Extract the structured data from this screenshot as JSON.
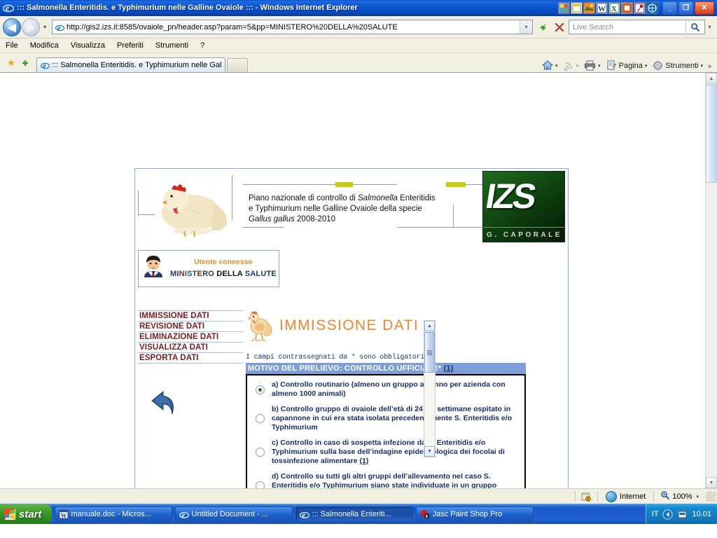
{
  "window": {
    "title": "::: Salmonella Enteritidis. e Typhimurium nelle Galline Ovaiole ::: - Windows Internet Explorer",
    "minimize_label": "_",
    "maximize_label": "❐",
    "close_label": "✕",
    "tray_icons": [
      "app-icon-1",
      "app-icon-2",
      "app-icon-3",
      "word-icon",
      "excel-icon",
      "app-icon-6",
      "app-icon-7",
      "app-icon-8"
    ]
  },
  "address_bar": {
    "back_label": "◀",
    "forward_label": "▶",
    "history_caret": "▾",
    "url": "http://gis2.izs.it:8585/ovaiole_pn/header.asp?param=5&pp=MINISTERO%20DELLA%20SALUTE",
    "url_dropdown": "▾",
    "refresh_label": "↯",
    "stop_label": "✕",
    "search_placeholder": "Live Search",
    "search_go": "search-icon",
    "search_dropdown": "▾"
  },
  "menu": {
    "items": [
      "File",
      "Modifica",
      "Visualizza",
      "Preferiti",
      "Strumenti",
      "?"
    ]
  },
  "tabs": {
    "favorites_star": "★",
    "add_favorite": "✚",
    "open_tab": "::: Salmonella Enteritidis. e Typhimurium nelle Galline ...",
    "new_tab_label": "",
    "toolbar_right": [
      {
        "icon": "home-icon",
        "label": "",
        "caret": "▾"
      },
      {
        "icon": "rss-icon",
        "label": "",
        "caret": "▾"
      },
      {
        "icon": "print-icon",
        "label": "",
        "caret": "▾"
      },
      {
        "icon": "page-icon",
        "label": "Pagina",
        "caret": "▾"
      },
      {
        "icon": "gear-icon",
        "label": "Strumenti",
        "caret": "▾"
      }
    ],
    "overflow": "»"
  },
  "page": {
    "banner": {
      "photo_alt": "hen-photo",
      "line1_prefix": "Piano nazionale di controllo di ",
      "line1_italic": "Salmonella",
      "line1_suffix": " Enteritidis",
      "line2": "e Typhimurium nelle Galline Ovaiole della specie",
      "line3_italic": "Gallus gallus",
      "line3_suffix": " 2008-2010",
      "logo_text": "IZS",
      "logo_caption": "G. CAPORALE"
    },
    "user_box": {
      "avatar": "user-avatar-icon",
      "status": "Utente connesso",
      "name_parts": [
        {
          "text": "MI",
          "color": "#1b3a6b"
        },
        {
          "text": "N",
          "color": "#8c1b1b"
        },
        {
          "text": "IST",
          "color": "#1b3a6b"
        },
        {
          "text": "E",
          "color": "#8c1b1b"
        },
        {
          "text": "RO ",
          "color": "#1b3a6b"
        },
        {
          "text": "DELLA ",
          "color": "#8c1b1b"
        },
        {
          "text": "SALUTE",
          "color": "#1b3a6b"
        }
      ],
      "name_plain": "MINISTERO DELLA SALUTE"
    },
    "nav": {
      "items": [
        "IMMISSIONE DATI",
        "REVISIONE DATI",
        "ELIMINAZIONE DATI",
        "VISUALIZZA DATI",
        "ESPORTA DATI"
      ]
    },
    "back_arrow": "back-arrow-icon",
    "content": {
      "title_icon": "hen-icon",
      "title": "IMMISSIONE DATI",
      "required_note": "I campi contrassegnati da * sono obbligatori",
      "section_header": "MOTIVO DEL PRELIEVO: CONTROLLO UFFICIALE*",
      "section_header_note": "(1)",
      "options": [
        {
          "id": "a",
          "selected": true,
          "text": "a) Controllo routinario (almeno un gruppo all’anno per azienda con almeno 1000 animali)"
        },
        {
          "id": "b",
          "selected": false,
          "text": "b) Controllo gruppo di ovaiole dell’età di 24 ± 2 settimane ospitato in capannone in cui era stata isolata precedentemente S. Enteritidis e/o Typhimurium"
        },
        {
          "id": "c",
          "selected": false,
          "text": "c) Controllo in caso di sospetta infezione da S. Enteritidis e/o Typhimurium sulla base dell’indagine epidemiologica dei focolai di tossinfezione alimentare ",
          "link": "(1)"
        },
        {
          "id": "d",
          "selected": false,
          "text": "d) Controllo su tutti gli altri gruppi dell’allevamento nel caso S. Enteritidis e/o Typhimurium siano state individuate in un gruppo dell’azienda"
        }
      ],
      "scroll_up": "▲",
      "scroll_down": "▼"
    }
  },
  "browser_scrollbar": {
    "up": "▲",
    "down": "▼"
  },
  "status_bar": {
    "message": "",
    "zone": "Internet",
    "zone_icon": "globe-icon",
    "protect_icon": "security-icon",
    "zoom_icon": "zoom-icon",
    "zoom": "100%",
    "zoom_caret": "▾"
  },
  "taskbar": {
    "start_label": "start",
    "items": [
      {
        "icon": "word-icon",
        "label": "manuale.doc - Micros...",
        "active": false
      },
      {
        "icon": "ie-icon",
        "label": "Untitled Document - ...",
        "active": false
      },
      {
        "icon": "ie-icon",
        "label": "::: Salmonella Enteriti...",
        "active": true
      },
      {
        "icon": "psp-icon",
        "label": "Jasc Paint Shop Pro",
        "active": false
      }
    ],
    "tray": {
      "language": "IT",
      "icons": [
        "shield-icon",
        "network-icon"
      ],
      "clock": "10.01"
    }
  },
  "colors": {
    "title_bar": "#0b55d4",
    "accent_orange": "#f0862e",
    "nav_red": "#7a1f1f",
    "section_blue": "#7d9ed6",
    "form_text_navy": "#16306b",
    "user_status_orange": "#e08a22",
    "logo_green": "#1f6e1f"
  }
}
